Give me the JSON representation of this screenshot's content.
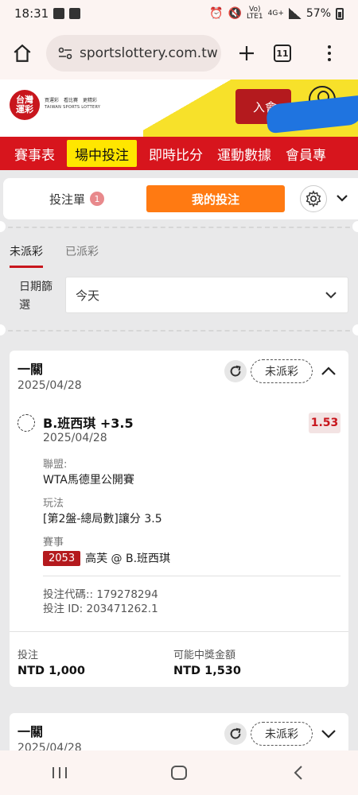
{
  "status": {
    "time": "18:31",
    "network_top": "Vo)",
    "network_mid": "LTE1",
    "network_type": "4G+",
    "battery": "57%"
  },
  "browser": {
    "url": "sportslottery.com.tw",
    "tab_count": "11"
  },
  "header": {
    "logo_text": "台灣\n運彩",
    "logo_tagline": "買運彩　看比賽　更精彩",
    "logo_sub": "TAIWAN SPORTS LOTTERY",
    "login_label": "入會"
  },
  "nav": {
    "items": [
      "賽事表",
      "場中投注",
      "即時比分",
      "運動數據",
      "會員專"
    ],
    "active_index": 1
  },
  "betbar": {
    "betslip_label": "投注單",
    "betslip_count": "1",
    "my_bets_label": "我的投注"
  },
  "filters": {
    "tabs": [
      "未派彩",
      "已派彩"
    ],
    "active_index": 0,
    "date_label": "日期篩選",
    "date_value": "今天"
  },
  "cards": [
    {
      "title": "一關",
      "date": "2025/04/28",
      "status": "未派彩",
      "selection": "B.班西琪 +3.5",
      "selection_date": "2025/04/28",
      "odds": "1.53",
      "league_label": "聯盟:",
      "league_value": "WTA馬德里公開賽",
      "play_label": "玩法",
      "play_value": "[第2盤-總局數]讓分 3.5",
      "event_label": "賽事",
      "event_code": "2053",
      "event_value": "高芙 @ B.班西琪",
      "bet_code": "投注代碼:: 179278294",
      "bet_id": "投注 ID: 203471262.1",
      "stake_label": "投注",
      "stake_value": "NTD 1,000",
      "payout_label": "可能中獎金額",
      "payout_value": "NTD 1,530"
    },
    {
      "title": "一關",
      "date": "2025/04/28",
      "status": "未派彩"
    }
  ]
}
